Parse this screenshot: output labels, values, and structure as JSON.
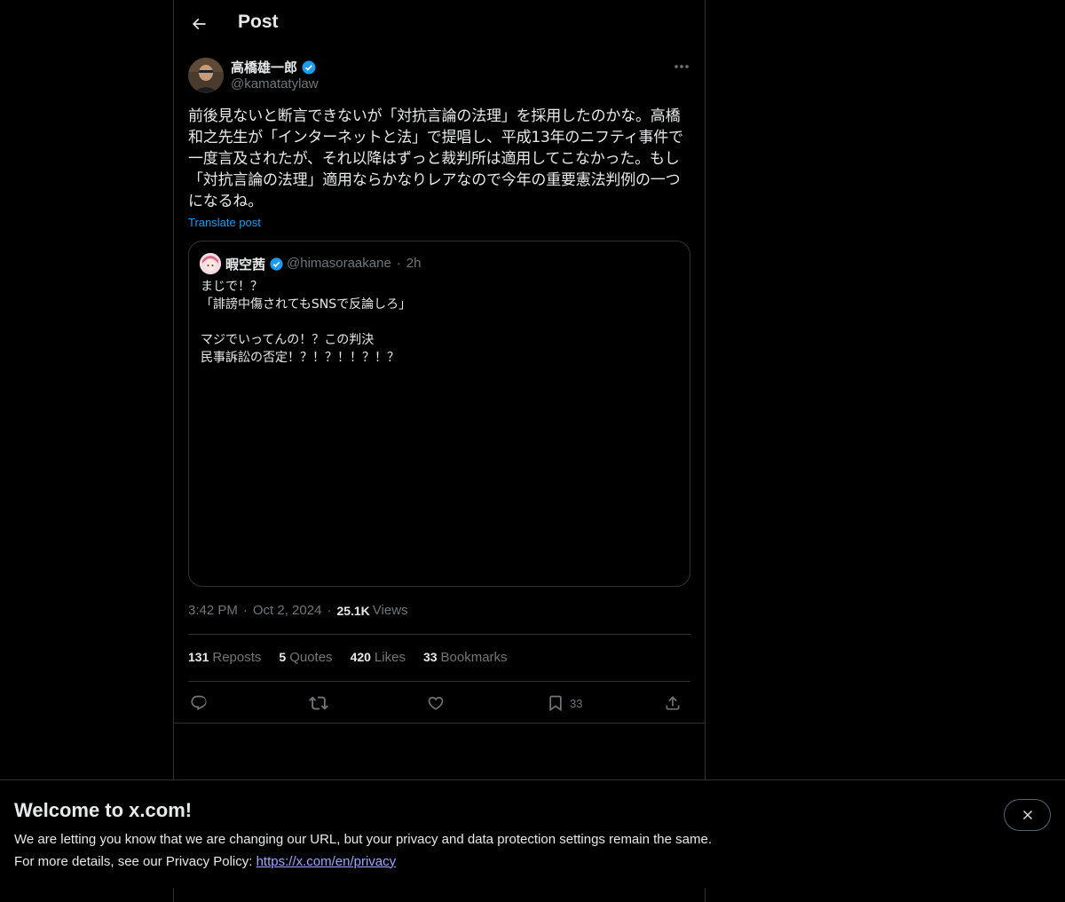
{
  "header": {
    "title": "Post"
  },
  "post": {
    "author_name": "高橋雄一郎",
    "author_handle": "@kamatatylaw",
    "text": "前後見ないと断言できないが「対抗言論の法理」を採用したのかな。高橋\n和之先生が「インターネットと法」で提唱し、平成13年のニフティ事件で\n一度言及されたが、それ以降はずっと裁判所は適用してこなかった。もし\n「対抗言論の法理」適用ならかなりレアなので今年の重要憲法判例の一つ\nになるね。",
    "translate_label": "Translate post",
    "time": "3:42 PM",
    "date": "Oct 2, 2024",
    "views_count": "25.1K",
    "views_label": "Views"
  },
  "quote": {
    "author_name": "暇空茜",
    "author_handle": "@himasoraakane",
    "age": "2h",
    "text": "まじで！？\n「誹謗中傷されてもSNSで反論しろ」\n\nマジでいってんの！？この判決\n民事訴訟の否定！？！？！！？！？"
  },
  "stats": {
    "reposts_count": "131",
    "reposts_label": "Reposts",
    "quotes_count": "5",
    "quotes_label": "Quotes",
    "likes_count": "420",
    "likes_label": "Likes",
    "bookmarks_count": "33",
    "bookmarks_label": "Bookmarks"
  },
  "actions": {
    "bookmark_count": "33"
  },
  "banner": {
    "title": "Welcome to x.com!",
    "line1": "We are letting you know that we are changing our URL, but your privacy and data protection settings remain the same.",
    "line2_prefix": "For more details, see our Privacy Policy: ",
    "line2_link": "https://x.com/en/privacy"
  },
  "colors": {
    "background": "#000000",
    "text": "#e7e9ea",
    "muted": "#71767b",
    "accent": "#1d9bf0",
    "border": "#2f3336",
    "verified": "#1d9bf0"
  }
}
